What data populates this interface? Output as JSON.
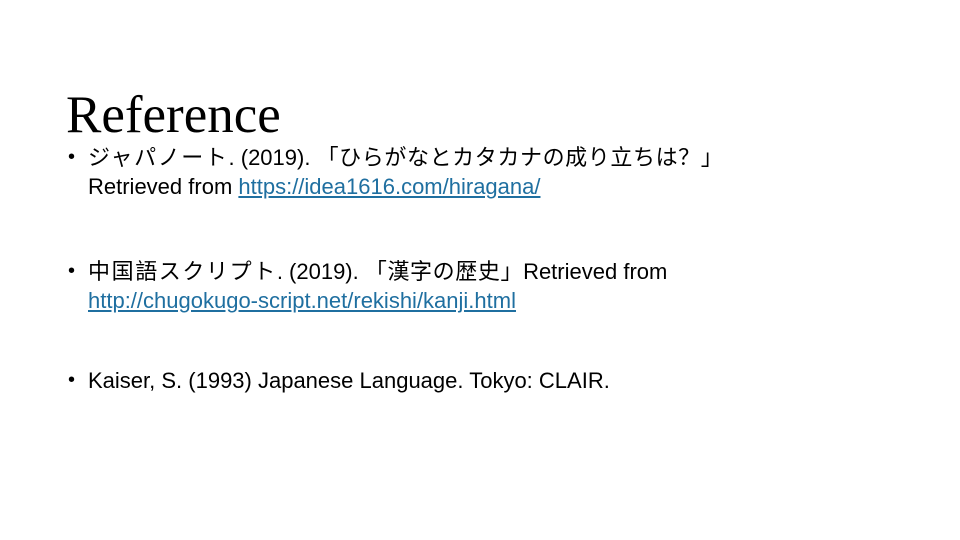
{
  "slide": {
    "title": "Reference",
    "background_color": "#FFFFFF",
    "text_color": "#000000",
    "link_color": "#1F6FA0",
    "bullet_marker": "•"
  },
  "references": [
    {
      "author": "ジャパノート",
      "separator_1": ". (2019). ",
      "title": "「ひらがなとカタカナの成り立ちは？」",
      "retrieved_label": "Retrieved from ",
      "url": "https://idea1616.com/hiragana/"
    },
    {
      "author": "中国語スクリプト",
      "separator_1": ". (2019). ",
      "title": "「漢字の歴史」",
      "retrieved_label": "Retrieved from",
      "url": "http://chugokugo-script.net/rekishi/kanji.html"
    },
    {
      "text": "Kaiser, S. (1993) Japanese Language. Tokyo: CLAIR."
    }
  ]
}
